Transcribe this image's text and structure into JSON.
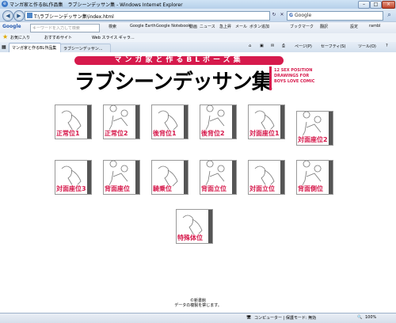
{
  "window": {
    "title": "マンガ家と作るBL作品集　ラブシーンデッサン集 - Windows Internet Explorer",
    "controls": [
      "–",
      "□",
      "×"
    ]
  },
  "address": {
    "url": "T:\\ラブシーンデッサン集\\index.html",
    "search_engine": "Google",
    "search_value": "Google"
  },
  "google_toolbar": {
    "logo": "Google",
    "input_placeholder": "キーワードを入力して検索",
    "search_label": "検索",
    "items": [
      "Google Earth",
      "Google Notebook",
      "動画",
      "ニュース",
      "急上昇",
      "メール",
      "ボタン追加"
    ],
    "bookmarks": "ブックマーク",
    "translate": "翻訳",
    "settings": "設定",
    "user": "rambl"
  },
  "favorites_bar": {
    "favorites": "お気に入り",
    "suggested": "おすすめサイト",
    "webslice": "Web スライス ギャラ..."
  },
  "tabs": [
    {
      "label": "マンガ家と作るBL作品集"
    },
    {
      "label": "ラブシーンデッサン..."
    }
  ],
  "command_bar": {
    "page": "ページ(P)",
    "safety": "セーフティ(S)",
    "tools": "ツール(O)",
    "help": "?"
  },
  "page": {
    "banner": "マンガ家と作るBLポーズ集",
    "title": "ラブシーンデッサン集",
    "subtitle_lines": [
      "12 SEX POSITION",
      "DRAWINGS FOR",
      "BOYS LOVE COMIC"
    ],
    "poses": [
      {
        "label": "正常位1"
      },
      {
        "label": "正常位2"
      },
      {
        "label": "後背位1"
      },
      {
        "label": "後背位2"
      },
      {
        "label": "対面座位1"
      },
      {
        "label": "対面座位2"
      },
      {
        "label": "対面座位3"
      },
      {
        "label": "背面座位"
      },
      {
        "label": "騎乗位"
      },
      {
        "label": "背面立位"
      },
      {
        "label": "対面立位"
      },
      {
        "label": "背面側位"
      },
      {
        "label": "特殊体位"
      }
    ],
    "copyright": "©新書館",
    "notice": "データの複製を禁じます。"
  },
  "status": {
    "zone": "コンピューター | 保護モード: 無効",
    "zoom": "100%"
  },
  "colors": {
    "accent": "#d61a4c"
  }
}
